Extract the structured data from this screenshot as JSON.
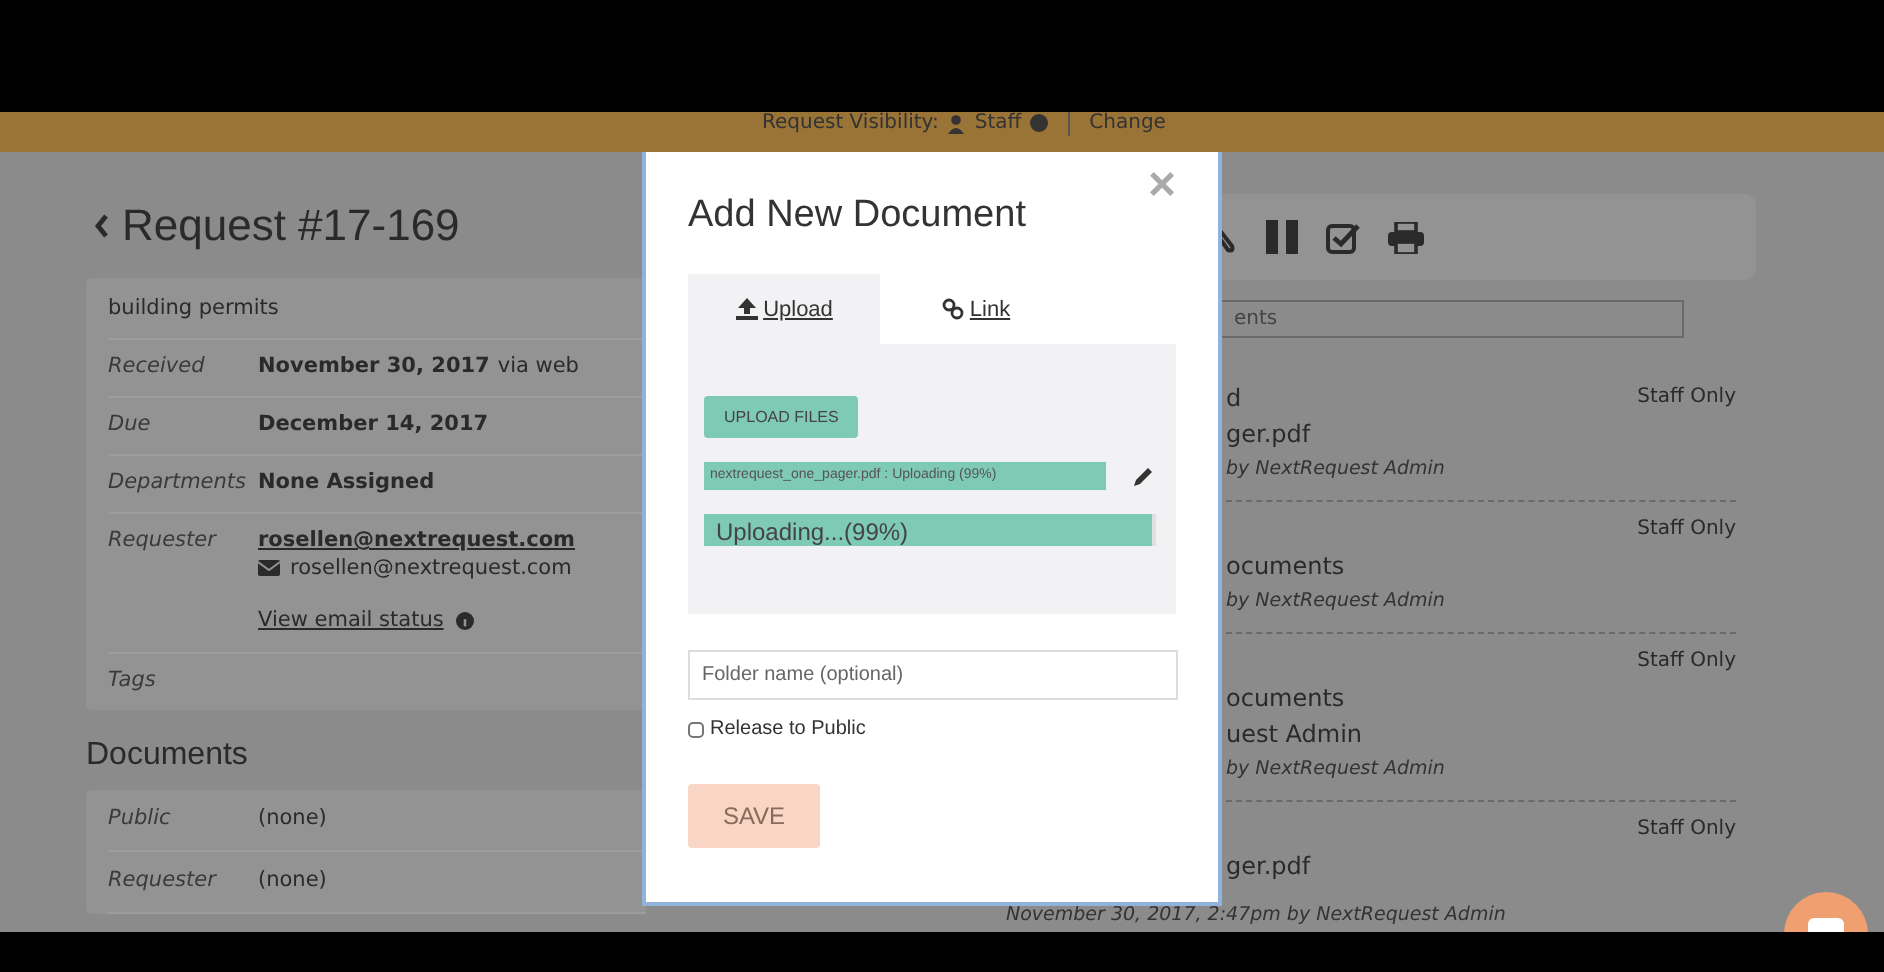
{
  "visibility_bar": {
    "label": "Request Visibility:",
    "value": "Staff",
    "action": "Change"
  },
  "request": {
    "title": "Request #17-169",
    "description": "building permits",
    "fields": [
      {
        "label": "Received",
        "value": "November 30, 2017",
        "suffix": "via web"
      },
      {
        "label": "Due",
        "value": "December 14, 2017"
      },
      {
        "label": "Departments",
        "value": "None Assigned"
      },
      {
        "label": "Requester",
        "value": "rosellen@nextrequest.com",
        "email": "rosellen@nextrequest.com",
        "link": "View email status"
      },
      {
        "label": "Tags"
      }
    ]
  },
  "documents": {
    "heading": "Documents",
    "rows": [
      {
        "label": "Public",
        "value": "(none)"
      },
      {
        "label": "Requester",
        "value": "(none)"
      }
    ]
  },
  "search": {
    "placeholder": "ents"
  },
  "entries": [
    {
      "lines": [
        "d",
        "ger.pdf"
      ],
      "meta": "by NextRequest Admin",
      "visibility": "Staff Only"
    },
    {
      "lines": [
        "ocuments"
      ],
      "meta": "by NextRequest Admin",
      "visibility": "Staff Only"
    },
    {
      "lines": [
        "ocuments",
        "uest Admin"
      ],
      "meta": "by NextRequest Admin",
      "visibility": "Staff Only"
    },
    {
      "lines": [
        "ger.pdf"
      ],
      "meta": "November 30, 2017, 2:47pm by NextRequest Admin",
      "visibility": "Staff Only"
    }
  ],
  "dialog": {
    "title": "Add New Document",
    "close": "×",
    "tabs": [
      {
        "label": "Upload",
        "kind": "upload",
        "selected": true
      },
      {
        "label": "Link",
        "kind": "link",
        "selected": false
      }
    ],
    "upload_button": "UPLOAD FILES",
    "file": "nextrequest_one_pager.pdf : Uploading (99%)",
    "progress": {
      "label": "Uploading...(99%)",
      "level": 0.99
    },
    "folder": {
      "placeholder": "Folder name (optional)"
    },
    "release": {
      "label": "Release to Public",
      "checked": false
    },
    "save": "SAVE"
  }
}
